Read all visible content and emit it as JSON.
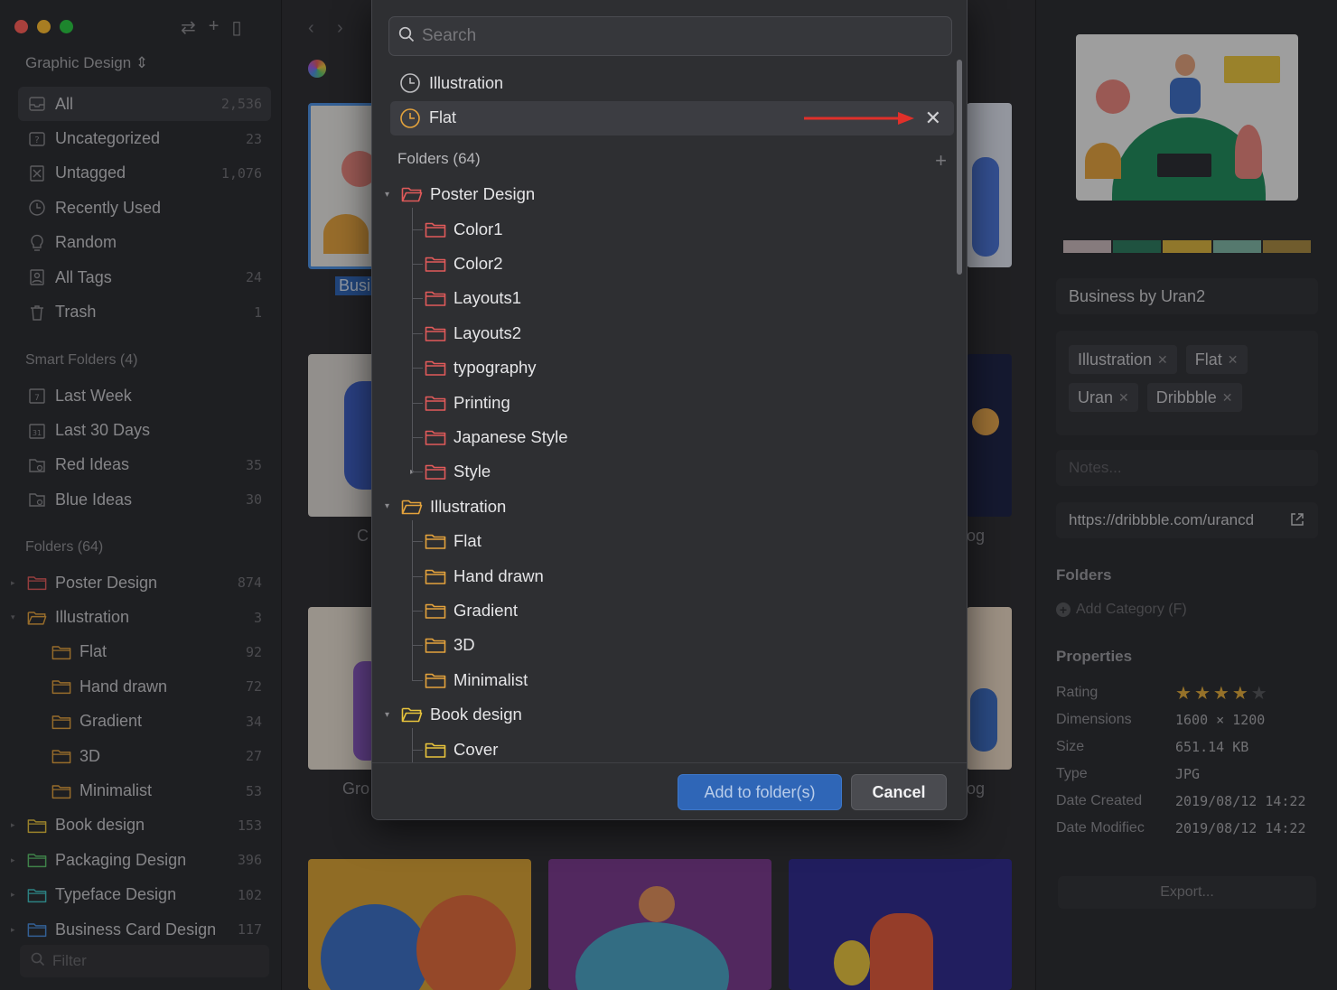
{
  "sidebar": {
    "library_name": "Graphic Design",
    "items": [
      {
        "label": "All",
        "count": "2,536",
        "icon": "inbox-icon"
      },
      {
        "label": "Uncategorized",
        "count": "23",
        "icon": "question-folder-icon"
      },
      {
        "label": "Untagged",
        "count": "1,076",
        "icon": "untagged-icon"
      },
      {
        "label": "Recently Used",
        "count": "",
        "icon": "clock-icon"
      },
      {
        "label": "Random",
        "count": "",
        "icon": "lightbulb-icon"
      },
      {
        "label": "All Tags",
        "count": "24",
        "icon": "tag-icon"
      },
      {
        "label": "Trash",
        "count": "1",
        "icon": "trash-icon"
      }
    ],
    "smart_folders_heading": "Smart Folders (4)",
    "smart_folders": [
      {
        "label": "Last Week",
        "count": "",
        "icon": "calendar-7-icon"
      },
      {
        "label": "Last 30 Days",
        "count": "",
        "icon": "calendar-31-icon"
      },
      {
        "label": "Red Ideas",
        "count": "35",
        "icon": "smart-folder-icon"
      },
      {
        "label": "Blue Ideas",
        "count": "30",
        "icon": "smart-folder-icon"
      }
    ],
    "folders_heading": "Folders (64)",
    "folders": [
      {
        "label": "Poster Design",
        "count": "874",
        "color": "#e05a5a",
        "level": 0,
        "caret": "▸"
      },
      {
        "label": "Illustration",
        "count": "3",
        "color": "#e3a23c",
        "level": 0,
        "caret": "▾"
      },
      {
        "label": "Flat",
        "count": "92",
        "color": "#e3a23c",
        "level": 1,
        "caret": ""
      },
      {
        "label": "Hand drawn",
        "count": "72",
        "color": "#e3a23c",
        "level": 1,
        "caret": ""
      },
      {
        "label": "Gradient",
        "count": "34",
        "color": "#e3a23c",
        "level": 1,
        "caret": ""
      },
      {
        "label": "3D",
        "count": "27",
        "color": "#e3a23c",
        "level": 1,
        "caret": ""
      },
      {
        "label": "Minimalist",
        "count": "53",
        "color": "#e3a23c",
        "level": 1,
        "caret": ""
      },
      {
        "label": "Book design",
        "count": "153",
        "color": "#e8c43c",
        "level": 0,
        "caret": "▸"
      },
      {
        "label": "Packaging Design",
        "count": "396",
        "color": "#5cc46a",
        "level": 0,
        "caret": "▸"
      },
      {
        "label": "Typeface Design",
        "count": "102",
        "color": "#3fc4c4",
        "level": 0,
        "caret": "▸"
      },
      {
        "label": "Business Card Design",
        "count": "117",
        "color": "#4a8fe0",
        "level": 0,
        "caret": "▸"
      }
    ],
    "filter_placeholder": "Filter"
  },
  "grid": {
    "captions": [
      "Busi",
      "C",
      "og",
      "Gro",
      "og"
    ]
  },
  "dialog": {
    "search_placeholder": "Search",
    "recent": [
      {
        "label": "Illustration",
        "highlighted": false
      },
      {
        "label": "Flat",
        "highlighted": true
      }
    ],
    "folders_heading": "Folders (64)",
    "tree": [
      {
        "label": "Poster Design",
        "level": 0,
        "color": "#e05a5a",
        "expander": "▾"
      },
      {
        "label": "Color1",
        "level": 1,
        "color": "#e05a5a",
        "expander": ""
      },
      {
        "label": "Color2",
        "level": 1,
        "color": "#e05a5a",
        "expander": ""
      },
      {
        "label": "Layouts1",
        "level": 1,
        "color": "#e05a5a",
        "expander": ""
      },
      {
        "label": "Layouts2",
        "level": 1,
        "color": "#e05a5a",
        "expander": ""
      },
      {
        "label": "typography",
        "level": 1,
        "color": "#e05a5a",
        "expander": ""
      },
      {
        "label": "Printing",
        "level": 1,
        "color": "#e05a5a",
        "expander": ""
      },
      {
        "label": "Japanese Style",
        "level": 1,
        "color": "#e05a5a",
        "expander": ""
      },
      {
        "label": "Style",
        "level": 1,
        "color": "#e05a5a",
        "expander": "▸"
      },
      {
        "label": "Illustration",
        "level": 0,
        "color": "#e3a23c",
        "expander": "▾"
      },
      {
        "label": "Flat",
        "level": 1,
        "color": "#e3a23c",
        "expander": ""
      },
      {
        "label": "Hand drawn",
        "level": 1,
        "color": "#e3a23c",
        "expander": ""
      },
      {
        "label": "Gradient",
        "level": 1,
        "color": "#e3a23c",
        "expander": ""
      },
      {
        "label": "3D",
        "level": 1,
        "color": "#e3a23c",
        "expander": ""
      },
      {
        "label": "Minimalist",
        "level": 1,
        "color": "#e3a23c",
        "expander": ""
      },
      {
        "label": "Book design",
        "level": 0,
        "color": "#e8c43c",
        "expander": "▾"
      },
      {
        "label": "Cover",
        "level": 1,
        "color": "#e8c43c",
        "expander": ""
      }
    ],
    "add_button": "Add to folder(s)",
    "cancel_button": "Cancel"
  },
  "inspector": {
    "palette": [
      "#c9b8bb",
      "#2c7a5c",
      "#d9b33d",
      "#7fb5a3",
      "#a8893f"
    ],
    "title": "Business by Uran2",
    "tags": [
      "Illustration",
      "Flat",
      "Uran",
      "Dribbble"
    ],
    "notes_placeholder": "Notes...",
    "url": "https://dribbble.com/urancd",
    "folders_heading": "Folders",
    "add_category": "Add Category (F)",
    "properties_heading": "Properties",
    "rating": 4,
    "rating_max": 5,
    "properties": [
      {
        "key": "Dimensions",
        "value": "1600 × 1200"
      },
      {
        "key": "Size",
        "value": "651.14 KB"
      },
      {
        "key": "Type",
        "value": "JPG"
      },
      {
        "key": "Date Created",
        "value": "2019/08/12 14:22"
      },
      {
        "key": "Date Modifiec",
        "value": "2019/08/12 14:22"
      }
    ],
    "rating_label": "Rating",
    "export_button": "Export..."
  }
}
